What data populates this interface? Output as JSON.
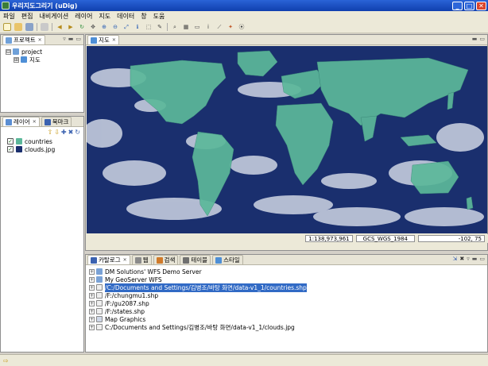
{
  "window": {
    "title": "우리지도그리기 (uDig)",
    "minimize": "_",
    "maximize": "□",
    "close": "✕"
  },
  "menubar": {
    "items": [
      "파일",
      "편집",
      "내비게이션",
      "레이어",
      "지도",
      "데이터",
      "창",
      "도움"
    ]
  },
  "project_panel": {
    "tab_label": "프로젝트",
    "tree": [
      {
        "label": "project",
        "expander": "⊟"
      },
      {
        "label": "지도",
        "expander": "⊞"
      }
    ]
  },
  "layer_panel": {
    "tabs": [
      "레이어",
      "북마크"
    ],
    "layers": [
      {
        "label": "countries"
      },
      {
        "label": "clouds.jpg"
      }
    ]
  },
  "map_panel": {
    "tab_label": "지도",
    "status": {
      "scale": "1:138,973,961",
      "crs": "GCS_WGS_1984",
      "coords": "-102, 75"
    }
  },
  "catalog_panel": {
    "tabs": [
      "카탈로그",
      "웹",
      "검색",
      "테이블",
      "스타일"
    ],
    "items": [
      {
        "label": "DM Solutions' WFS Demo Server",
        "selected": false
      },
      {
        "label": "My GeoServer WFS",
        "selected": false
      },
      {
        "label": "/C:/Documents and Settings/김병조/바탕 화면/data-v1_1/countries.shp",
        "selected": true
      },
      {
        "label": "/F:/chungmu1.shp",
        "selected": false
      },
      {
        "label": "/F:/gu2087.shp",
        "selected": false
      },
      {
        "label": "/F:/states.shp",
        "selected": false
      },
      {
        "label": "Map Graphics",
        "selected": false
      },
      {
        "label": "C:/Documents and Settings/김병조/바탕 화면/data-v1_1/clouds.jpg",
        "selected": false
      }
    ]
  },
  "colors": {
    "titlebar": "#0f3fae",
    "land": "#5cb89a",
    "ocean": "#1a2f6e",
    "selection": "#316ac5"
  }
}
